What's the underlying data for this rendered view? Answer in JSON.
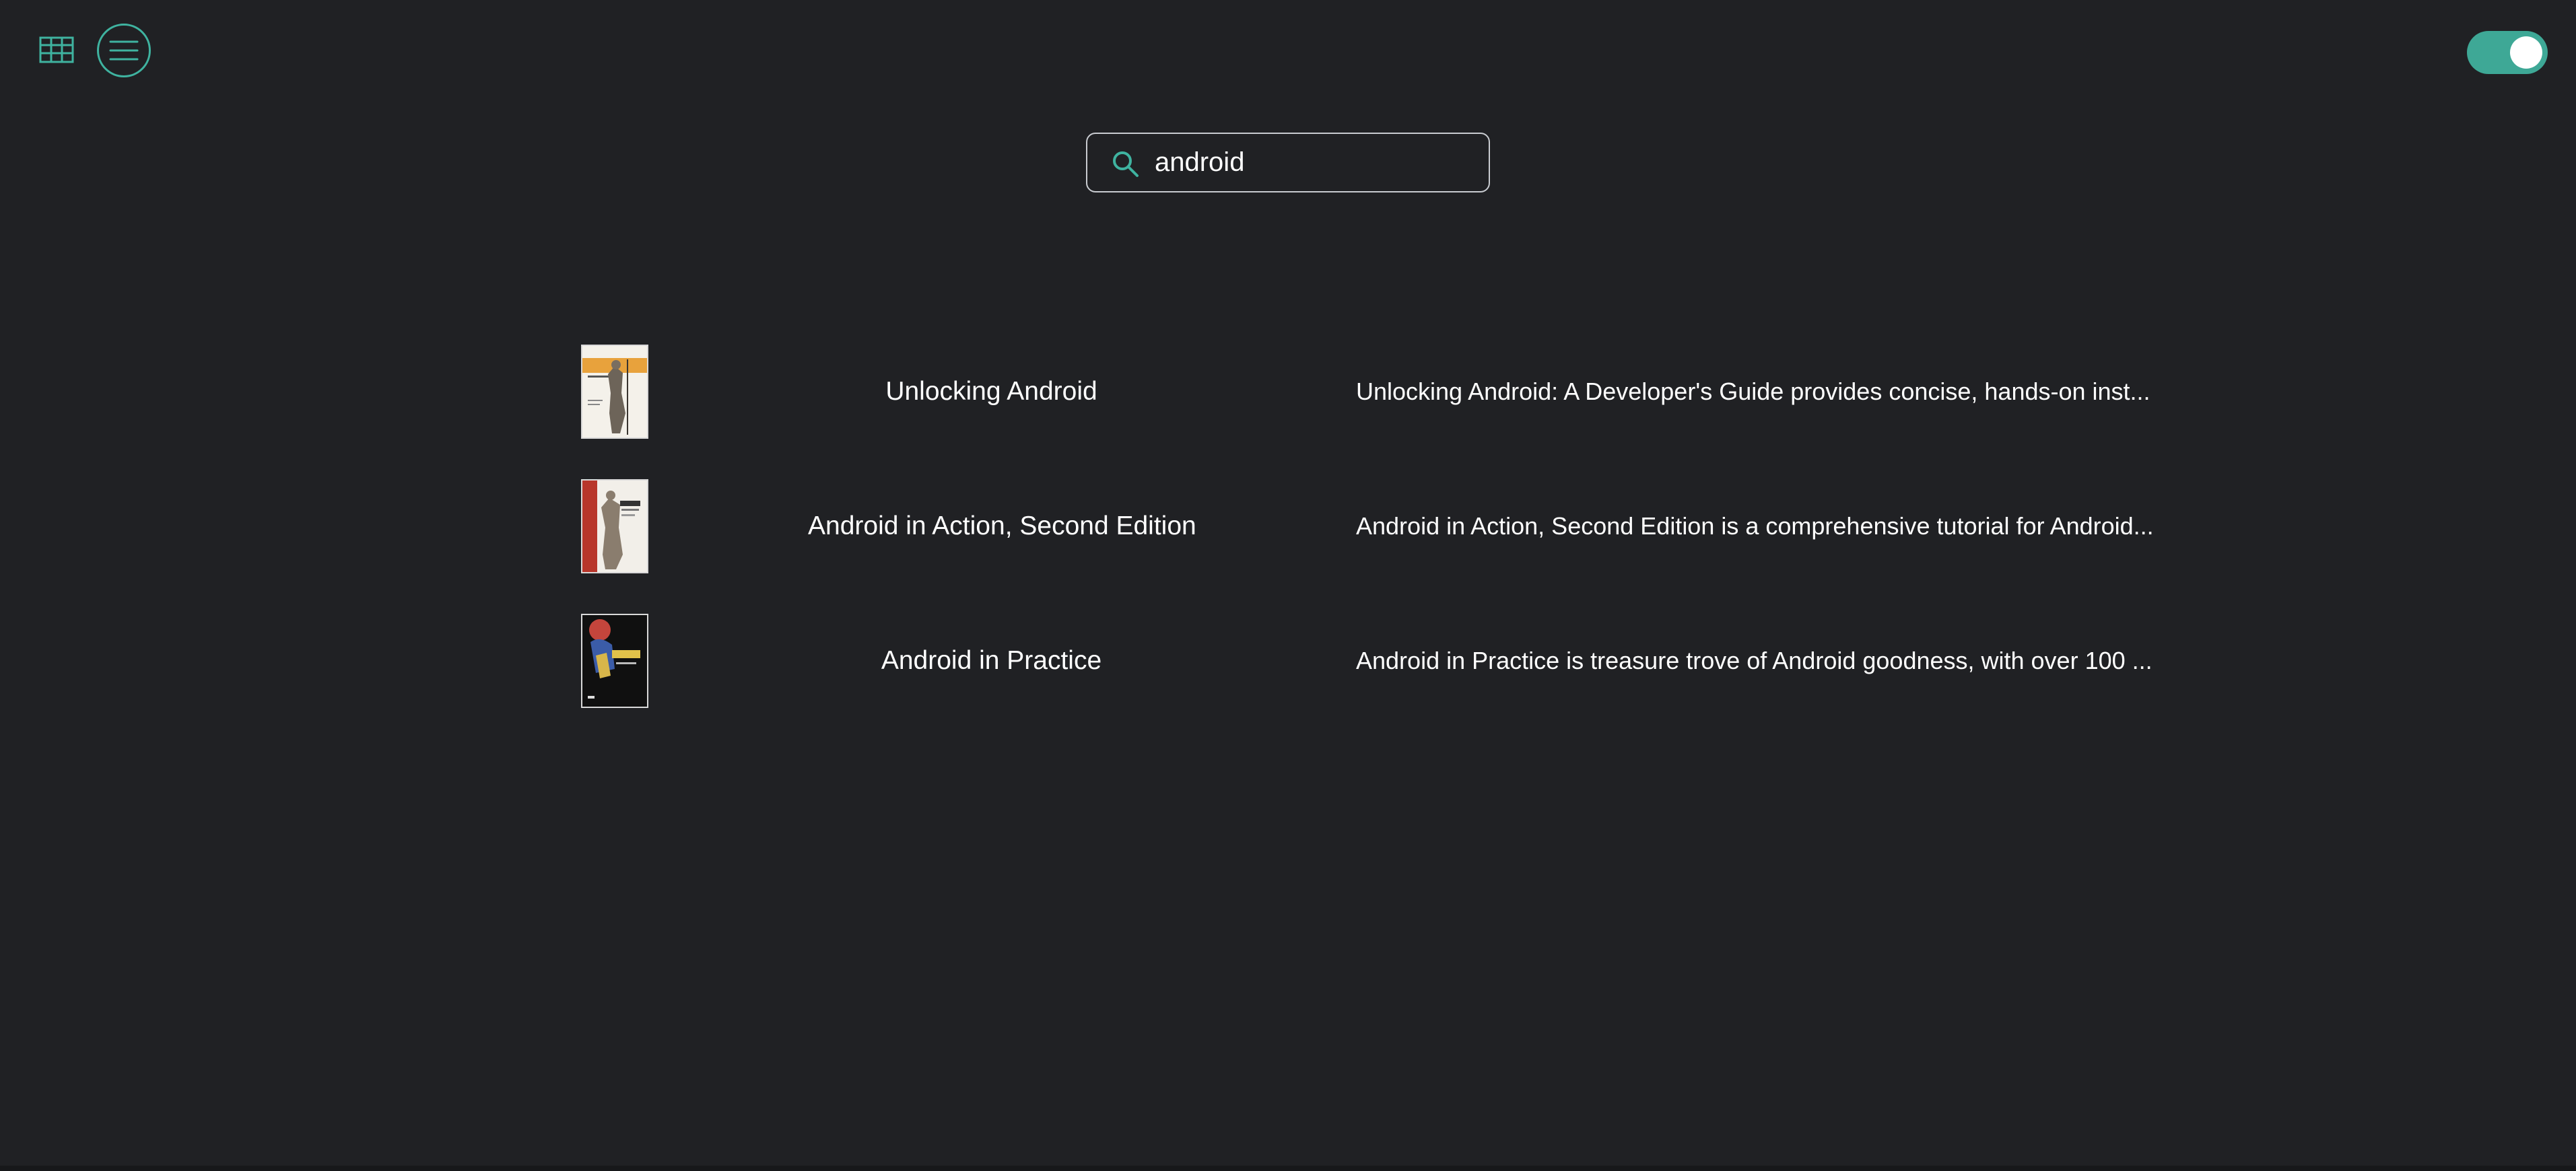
{
  "toolbar": {
    "grid_icon": "grid-view-icon",
    "menu_icon": "hamburger-menu-icon",
    "toggle_state": "on",
    "accent_color": "#3ea896"
  },
  "search": {
    "value": "android",
    "icon": "search-icon"
  },
  "results": [
    {
      "title": "Unlocking Android",
      "description": "Unlocking Android: A Developer's Guide provides concise, hands-on inst..."
    },
    {
      "title": "Android in Action, Second Edition",
      "description": "Android in Action, Second Edition is a comprehensive tutorial for Android..."
    },
    {
      "title": "Android in Practice",
      "description": "Android in Practice is treasure trove of Android goodness, with over 100 ..."
    }
  ]
}
